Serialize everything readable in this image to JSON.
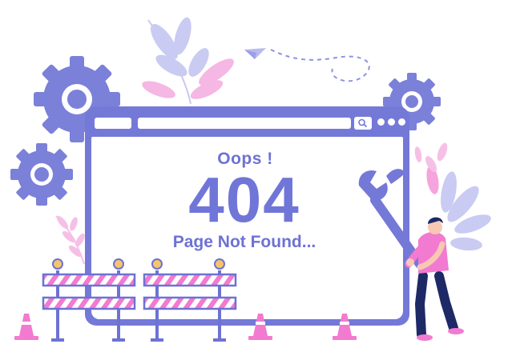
{
  "error_page": {
    "headline": "Oops !",
    "code": "404",
    "message": "Page Not Found..."
  },
  "icons": {
    "search": "search-icon",
    "menu": "more-dots-icon",
    "gear": "gear-icon",
    "wrench": "wrench-icon",
    "paper_plane": "paper-plane-icon",
    "traffic_cone": "traffic-cone-icon",
    "barrier": "road-barrier-icon"
  },
  "colors": {
    "primary": "#7479d8",
    "accent_pink": "#f27ad0",
    "light_purple": "#a9acee",
    "text": "#6d72d3"
  }
}
